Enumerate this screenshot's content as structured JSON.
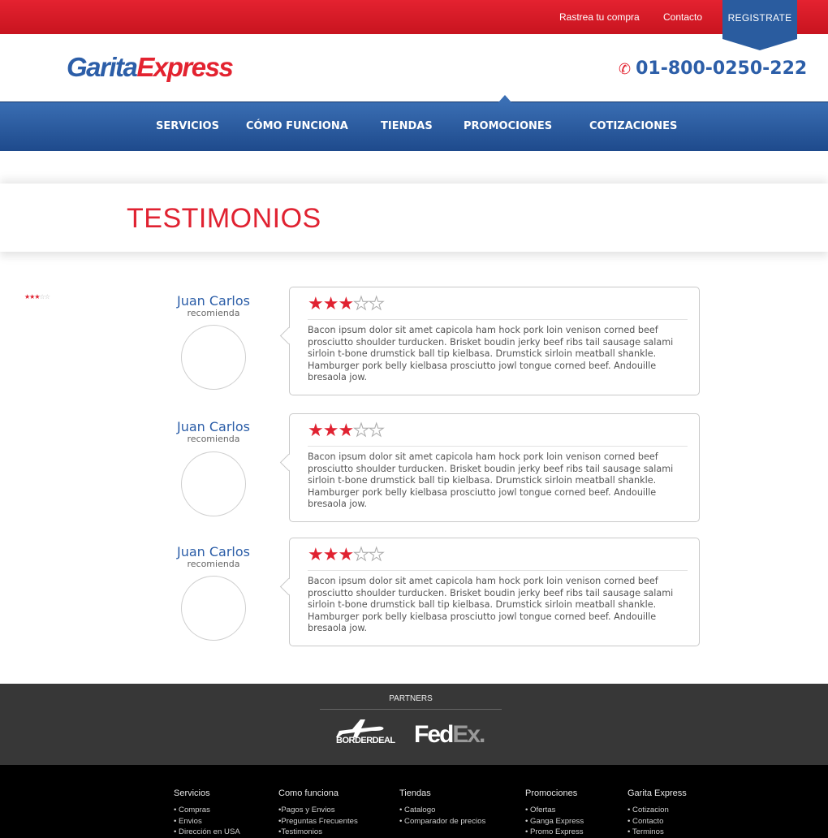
{
  "topbar": {
    "track_label": "Rastrea tu compra",
    "contact_label": "Contacto",
    "register_label": "REGISTRATE"
  },
  "brand": {
    "logo_part1": "Garita",
    "logo_part2": "Express",
    "phone": "01-800-0250-222"
  },
  "nav": {
    "items": [
      "SERVICIOS",
      "CÓMO FUNCIONA",
      "TIENDAS",
      "PROMOCIONES",
      "COTIZACIONES"
    ],
    "active": "PROMOCIONES"
  },
  "page": {
    "title": "TESTIMONIOS"
  },
  "mini_rating": {
    "stars": 3,
    "max": 5
  },
  "testimonials": [
    {
      "name": "Juan Carlos",
      "subtitle": "recomienda",
      "stars": 3,
      "max": 5,
      "text": "Bacon ipsum dolor sit amet capicola ham hock pork loin venison corned beef prosciutto shoulder turducken. Brisket boudin jerky beef ribs tail sausage salami sirloin t-bone drumstick ball tip kielbasa. Drumstick sirloin meatball shankle. Hamburger pork belly kielbasa prosciutto jowl tongue corned beef. Andouille bresaola jow."
    },
    {
      "name": "Juan Carlos",
      "subtitle": "recomienda",
      "stars": 3,
      "max": 5,
      "text": "Bacon ipsum dolor sit amet capicola ham hock pork loin venison corned beef prosciutto shoulder turducken. Brisket boudin jerky beef ribs tail sausage salami sirloin t-bone drumstick ball tip kielbasa. Drumstick sirloin meatball shankle. Hamburger pork belly kielbasa prosciutto jowl tongue corned beef. Andouille bresaola jow."
    },
    {
      "name": "Juan Carlos",
      "subtitle": "recomienda",
      "stars": 3,
      "max": 5,
      "text": "Bacon ipsum dolor sit amet capicola ham hock pork loin venison corned beef prosciutto shoulder turducken. Brisket boudin jerky beef ribs tail sausage salami sirloin t-bone drumstick ball tip kielbasa. Drumstick sirloin meatball shankle. Hamburger pork belly kielbasa prosciutto jowl tongue corned beef. Andouille bresaola jow."
    }
  ],
  "partners": {
    "title": "PARTNERS",
    "borderdeal_label": "BORDERDEAL",
    "fedex_part1": "Fed",
    "fedex_part2": "Ex",
    "fedex_dot": "."
  },
  "footer": {
    "columns": [
      {
        "heading": "Servicios",
        "items": [
          "• Compras",
          "• Envios",
          "• Dirección en USA"
        ]
      },
      {
        "heading": "Como funciona",
        "items": [
          "•Pagos y Envios",
          "•Preguntas Frecuentes",
          "•Testimonios"
        ]
      },
      {
        "heading": "Tiendas",
        "items": [
          "• Catalogo",
          "• Comparador de precios"
        ]
      },
      {
        "heading": "Promociones",
        "items": [
          "• Ofertas",
          "• Ganga Express",
          "• Promo Express"
        ]
      },
      {
        "heading": "Garita Express",
        "items": [
          "• Cotizacion",
          "• Contacto",
          "• Terminos"
        ]
      }
    ]
  },
  "colors": {
    "red": "#e02231",
    "blue": "#2c5ea8",
    "nav_blue": "#2a5c9f",
    "footer_gray": "#373737"
  }
}
